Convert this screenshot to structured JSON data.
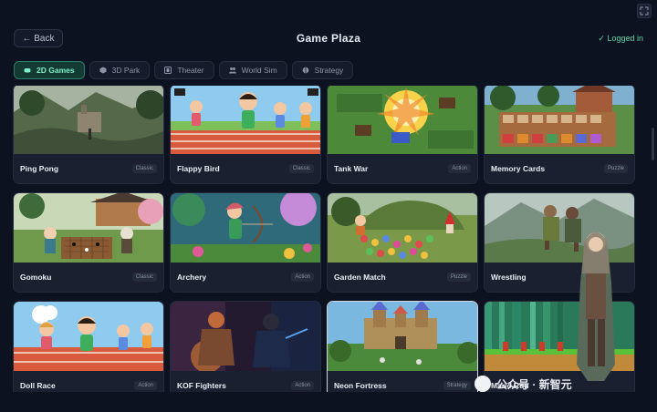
{
  "header": {
    "back_label": "← Back",
    "title": "Game Plaza",
    "status": "✓ Logged in"
  },
  "tabs": [
    {
      "label": "2D Games",
      "active": true,
      "icon": "gamepad-icon"
    },
    {
      "label": "3D Park",
      "active": false,
      "icon": "cube-icon"
    },
    {
      "label": "Theater",
      "active": false,
      "icon": "film-icon"
    },
    {
      "label": "World Sim",
      "active": false,
      "icon": "users-icon"
    },
    {
      "label": "Strategy",
      "active": false,
      "icon": "brain-icon"
    }
  ],
  "games": [
    {
      "name": "Ping Pong",
      "tag": "Classic",
      "scene": "forest-ruins"
    },
    {
      "name": "Flappy Bird",
      "tag": "Classic",
      "scene": "race-kids"
    },
    {
      "name": "Tank War",
      "tag": "Action",
      "scene": "explosion"
    },
    {
      "name": "Memory Cards",
      "tag": "Puzzle",
      "scene": "village-board"
    },
    {
      "name": "Gomoku",
      "tag": "Classic",
      "scene": "go-board"
    },
    {
      "name": "Archery",
      "tag": "Action",
      "scene": "archer"
    },
    {
      "name": "Garden Match",
      "tag": "Puzzle",
      "scene": "garden"
    },
    {
      "name": "Wrestling",
      "tag": "",
      "scene": "wrestlers"
    },
    {
      "name": "Doll Race",
      "tag": "Action",
      "scene": "race-kids"
    },
    {
      "name": "KOF Fighters",
      "tag": "Action",
      "scene": "fighters"
    },
    {
      "name": "Neon Fortress",
      "tag": "Strategy",
      "scene": "castle"
    },
    {
      "name": "Mario Run",
      "tag": "",
      "scene": "pixel-run"
    }
  ],
  "watermark": "公众号 · 新智元",
  "colors": {
    "accent": "#5fd8a8",
    "background": "#0d1220",
    "card": "#1a2030"
  }
}
